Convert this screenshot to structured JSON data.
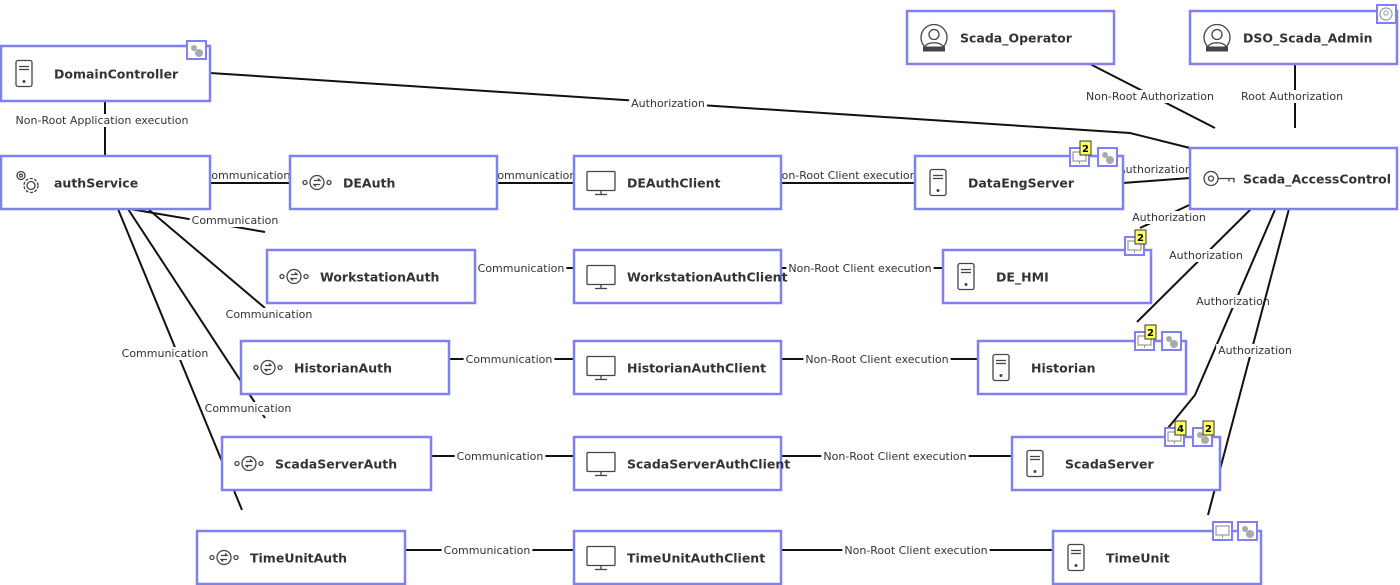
{
  "nodes": [
    {
      "id": "DomainController",
      "label": "DomainController",
      "icon": "server-icon",
      "badges": [
        {
          "icon": "gear-icon"
        }
      ]
    },
    {
      "id": "authService",
      "label": "authService",
      "icon": "gears-icon",
      "badges": []
    },
    {
      "id": "DEAuth",
      "label": "DEAuth",
      "icon": "service-icon",
      "badges": []
    },
    {
      "id": "DEAuthClient",
      "label": "DEAuthClient",
      "icon": "monitor-icon",
      "badges": []
    },
    {
      "id": "DataEngServer",
      "label": "DataEngServer",
      "icon": "server-icon",
      "badges": [
        {
          "icon": "monitor-icon",
          "count": "2"
        },
        {
          "icon": "gear-icon"
        }
      ]
    },
    {
      "id": "Scada_AccessControl",
      "label": "Scada_AccessControl",
      "icon": "key-icon",
      "badges": []
    },
    {
      "id": "Scada_Operator",
      "label": "Scada_Operator",
      "icon": "user-icon",
      "badges": []
    },
    {
      "id": "DSO_Scada_Admin",
      "label": "DSO_Scada_Admin",
      "icon": "user-icon",
      "badges": [
        {
          "icon": "user-icon"
        }
      ]
    },
    {
      "id": "WorkstationAuth",
      "label": "WorkstationAuth",
      "icon": "service-icon",
      "badges": []
    },
    {
      "id": "WorkstationAuthClient",
      "label": "WorkstationAuthClient",
      "icon": "monitor-icon",
      "badges": []
    },
    {
      "id": "DE_HMI",
      "label": "DE_HMI",
      "icon": "server-icon",
      "badges": [
        {
          "icon": "monitor-icon",
          "count": "2"
        }
      ]
    },
    {
      "id": "HistorianAuth",
      "label": "HistorianAuth",
      "icon": "service-icon",
      "badges": []
    },
    {
      "id": "HistorianAuthClient",
      "label": "HistorianAuthClient",
      "icon": "monitor-icon",
      "badges": []
    },
    {
      "id": "Historian",
      "label": "Historian",
      "icon": "server-icon",
      "badges": [
        {
          "icon": "monitor-icon",
          "count": "2"
        },
        {
          "icon": "gear-icon"
        }
      ]
    },
    {
      "id": "ScadaServerAuth",
      "label": "ScadaServerAuth",
      "icon": "service-icon",
      "badges": []
    },
    {
      "id": "ScadaServerAuthClient",
      "label": "ScadaServerAuthClient",
      "icon": "monitor-icon",
      "badges": []
    },
    {
      "id": "ScadaServer",
      "label": "ScadaServer",
      "icon": "server-icon",
      "badges": [
        {
          "icon": "monitor-icon",
          "count": "4"
        },
        {
          "icon": "gear-icon",
          "count": "2"
        }
      ]
    },
    {
      "id": "TimeUnitAuth",
      "label": "TimeUnitAuth",
      "icon": "service-icon",
      "badges": []
    },
    {
      "id": "TimeUnitAuthClient",
      "label": "TimeUnitAuthClient",
      "icon": "monitor-icon",
      "badges": []
    },
    {
      "id": "TimeUnit",
      "label": "TimeUnit",
      "icon": "server-icon",
      "badges": [
        {
          "icon": "monitor-icon"
        },
        {
          "icon": "gear-icon"
        }
      ]
    }
  ],
  "edges": [
    {
      "from": "DomainController",
      "to": "authService",
      "label": "Non-Root Application execution"
    },
    {
      "from": "DomainController",
      "to": "Scada_AccessControl",
      "label": "Authorization"
    },
    {
      "from": "Scada_Operator",
      "to": "Scada_AccessControl",
      "label": "Non-Root Authorization"
    },
    {
      "from": "DSO_Scada_Admin",
      "to": "Scada_AccessControl",
      "label": "Root Authorization"
    },
    {
      "from": "authService",
      "to": "DEAuth",
      "label": "Communication"
    },
    {
      "from": "DEAuth",
      "to": "DEAuthClient",
      "label": "Communication"
    },
    {
      "from": "DEAuthClient",
      "to": "DataEngServer",
      "label": "Non-Root Client execution"
    },
    {
      "from": "DataEngServer",
      "to": "Scada_AccessControl",
      "label": "Authorization"
    },
    {
      "from": "authService",
      "to": "WorkstationAuth",
      "label": "Communication"
    },
    {
      "from": "authService",
      "to": "HistorianAuth",
      "label": "Communication"
    },
    {
      "from": "authService",
      "to": "ScadaServerAuth",
      "label": "Communication"
    },
    {
      "from": "authService",
      "to": "TimeUnitAuth",
      "label": "Communication"
    },
    {
      "from": "WorkstationAuth",
      "to": "WorkstationAuthClient",
      "label": "Communication"
    },
    {
      "from": "WorkstationAuthClient",
      "to": "DE_HMI",
      "label": "Non-Root Client execution"
    },
    {
      "from": "HistorianAuth",
      "to": "HistorianAuthClient",
      "label": "Communication"
    },
    {
      "from": "HistorianAuthClient",
      "to": "Historian",
      "label": "Non-Root Client execution"
    },
    {
      "from": "ScadaServerAuth",
      "to": "ScadaServerAuthClient",
      "label": "Communication"
    },
    {
      "from": "ScadaServerAuthClient",
      "to": "ScadaServer",
      "label": "Non-Root Client execution"
    },
    {
      "from": "TimeUnitAuth",
      "to": "TimeUnitAuthClient",
      "label": "Communication"
    },
    {
      "from": "TimeUnitAuthClient",
      "to": "TimeUnit",
      "label": "Non-Root Client execution"
    },
    {
      "from": "Scada_AccessControl",
      "to": "DE_HMI",
      "label": "Authorization"
    },
    {
      "from": "Scada_AccessControl",
      "to": "Historian",
      "label": "Authorization"
    },
    {
      "from": "Scada_AccessControl",
      "to": "ScadaServer",
      "label": "Authorization"
    },
    {
      "from": "Scada_AccessControl",
      "to": "TimeUnit",
      "label": "Authorization"
    }
  ],
  "colors": {
    "node_border": "#8080f0",
    "badge_count": "#ffff66",
    "edge": "#111111"
  }
}
